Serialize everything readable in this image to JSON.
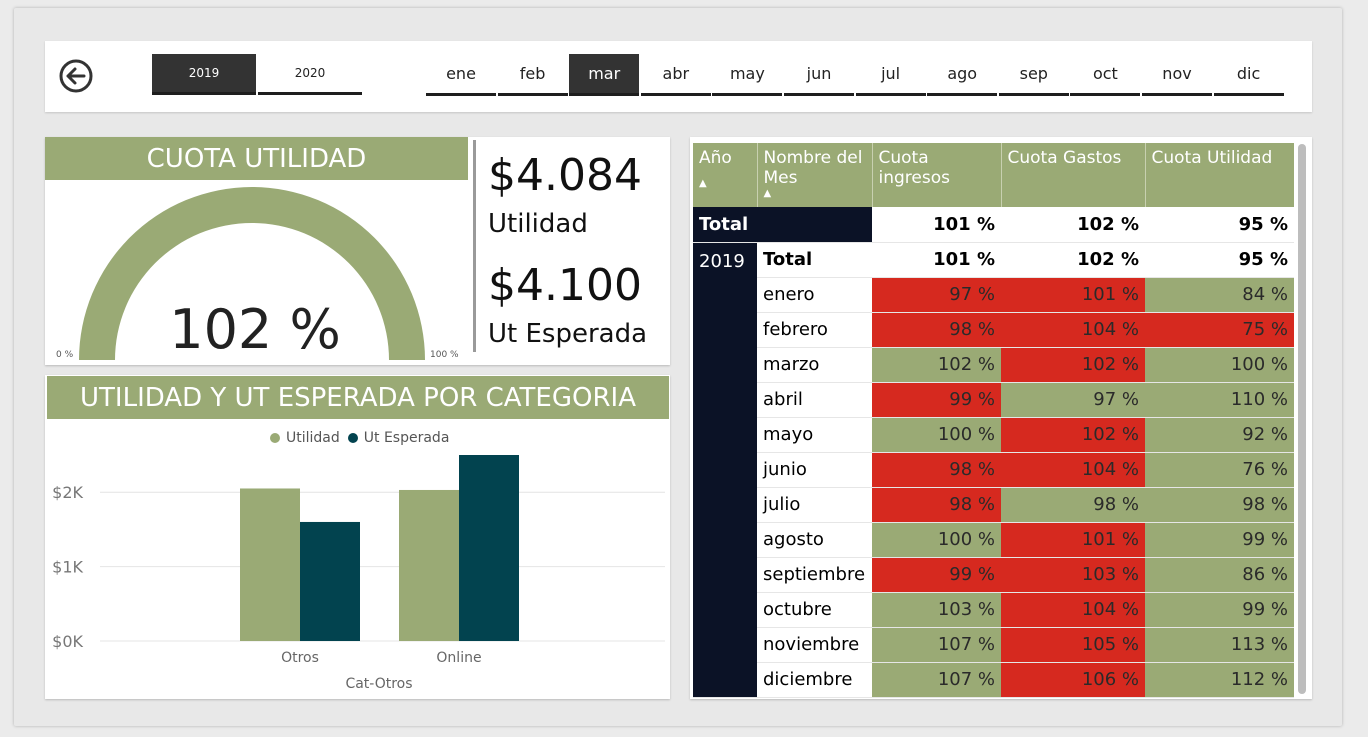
{
  "years": [
    {
      "label": "2019",
      "selected": true
    },
    {
      "label": "2020",
      "selected": false
    }
  ],
  "months": [
    {
      "label": "ene",
      "selected": false
    },
    {
      "label": "feb",
      "selected": false
    },
    {
      "label": "mar",
      "selected": true
    },
    {
      "label": "abr",
      "selected": false
    },
    {
      "label": "may",
      "selected": false
    },
    {
      "label": "jun",
      "selected": false
    },
    {
      "label": "jul",
      "selected": false
    },
    {
      "label": "ago",
      "selected": false
    },
    {
      "label": "sep",
      "selected": false
    },
    {
      "label": "oct",
      "selected": false
    },
    {
      "label": "nov",
      "selected": false
    },
    {
      "label": "dic",
      "selected": false
    }
  ],
  "gauge": {
    "title": "CUOTA UTILIDAD",
    "value": "102 %",
    "min_label": "0 %",
    "max_label": "100 %",
    "fill_fraction": 1.0,
    "color": "#9aaa75"
  },
  "kpis": {
    "utilidad": {
      "value": "$4.084",
      "label": "Utilidad"
    },
    "esperada": {
      "value": "$4.100",
      "label": "Ut Esperada"
    }
  },
  "bar_panel": {
    "title": "UTILIDAD Y UT ESPERADA POR CATEGORIA"
  },
  "chart_data": {
    "type": "bar",
    "title": "",
    "xlabel": "Cat-Otros",
    "ylabel": "",
    "categories": [
      "Otros",
      "Online"
    ],
    "series": [
      {
        "name": "Utilidad",
        "values": [
          2050,
          2030
        ],
        "color": "#9aaa75"
      },
      {
        "name": "Ut Esperada",
        "values": [
          1600,
          2500
        ],
        "color": "#02434f"
      }
    ],
    "ylim": [
      0,
      2500
    ],
    "yticks": [
      {
        "v": 0,
        "label": "$0K"
      },
      {
        "v": 1000,
        "label": "$1K"
      },
      {
        "v": 2000,
        "label": "$2K"
      }
    ],
    "legend": "top-center",
    "grid": true
  },
  "matrix": {
    "headers": {
      "year": "Año",
      "month": "Nombre del Mes",
      "ingresos": "Cuota ingresos",
      "gastos": "Cuota Gastos",
      "utilidad": "Cuota Utilidad"
    },
    "grand_total": {
      "label": "Total",
      "ingresos": "101 %",
      "gastos": "102 %",
      "utilidad": "95 %"
    },
    "year": "2019",
    "year_total": {
      "label": "Total",
      "ingresos": "101 %",
      "gastos": "102 %",
      "utilidad": "95 %"
    },
    "rows": [
      {
        "mes": "enero",
        "ingresos": "97 %",
        "gastos": "101 %",
        "utilidad": "84 %",
        "ci": "red",
        "cg": "red",
        "cu": "grn"
      },
      {
        "mes": "febrero",
        "ingresos": "98 %",
        "gastos": "104 %",
        "utilidad": "75 %",
        "ci": "red",
        "cg": "red",
        "cu": "red"
      },
      {
        "mes": "marzo",
        "ingresos": "102 %",
        "gastos": "102 %",
        "utilidad": "100 %",
        "ci": "grn",
        "cg": "red",
        "cu": "grn"
      },
      {
        "mes": "abril",
        "ingresos": "99 %",
        "gastos": "97 %",
        "utilidad": "110 %",
        "ci": "red",
        "cg": "grn",
        "cu": "grn"
      },
      {
        "mes": "mayo",
        "ingresos": "100 %",
        "gastos": "102 %",
        "utilidad": "92 %",
        "ci": "grn",
        "cg": "red",
        "cu": "grn"
      },
      {
        "mes": "junio",
        "ingresos": "98 %",
        "gastos": "104 %",
        "utilidad": "76 %",
        "ci": "red",
        "cg": "red",
        "cu": "grn"
      },
      {
        "mes": "julio",
        "ingresos": "98 %",
        "gastos": "98 %",
        "utilidad": "98 %",
        "ci": "red",
        "cg": "grn",
        "cu": "grn"
      },
      {
        "mes": "agosto",
        "ingresos": "100 %",
        "gastos": "101 %",
        "utilidad": "99 %",
        "ci": "grn",
        "cg": "red",
        "cu": "grn"
      },
      {
        "mes": "septiembre",
        "ingresos": "99 %",
        "gastos": "103 %",
        "utilidad": "86 %",
        "ci": "red",
        "cg": "red",
        "cu": "grn"
      },
      {
        "mes": "octubre",
        "ingresos": "103 %",
        "gastos": "104 %",
        "utilidad": "99 %",
        "ci": "grn",
        "cg": "red",
        "cu": "grn"
      },
      {
        "mes": "noviembre",
        "ingresos": "107 %",
        "gastos": "105 %",
        "utilidad": "113 %",
        "ci": "grn",
        "cg": "red",
        "cu": "grn"
      },
      {
        "mes": "diciembre",
        "ingresos": "107 %",
        "gastos": "106 %",
        "utilidad": "112 %",
        "ci": "grn",
        "cg": "red",
        "cu": "grn"
      }
    ]
  }
}
